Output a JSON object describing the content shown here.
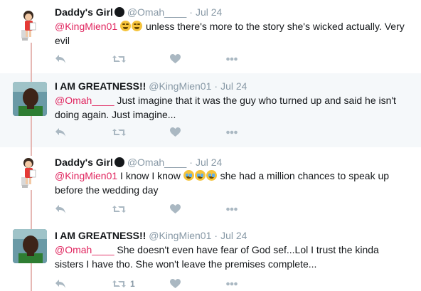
{
  "tweets": [
    {
      "author_name": "Daddy's Girl",
      "handle": "@Omah____",
      "time": "Jul 24",
      "mention": "@KingMien01",
      "emojis": [
        "joy-emoji",
        "joy-emoji"
      ],
      "text": "unless there's more to the story she's wicked actually. Very evil",
      "retweet_count": ""
    },
    {
      "author_name": "I AM GREATNESS!!",
      "handle": "@KingMien01",
      "time": "Jul 24",
      "mention": "@Omah____",
      "text": "Just imagine that it was the guy who turned up and said he isn't doing again. Just imagine...",
      "retweet_count": ""
    },
    {
      "author_name": "Daddy's Girl",
      "handle": "@Omah____",
      "time": "Jul 24",
      "mention": "@KingMien01",
      "text_before": "I know I know",
      "emojis": [
        "sob-emoji",
        "sob-emoji",
        "sob-emoji"
      ],
      "text": "she had a million chances to speak up before the wedding day",
      "retweet_count": ""
    },
    {
      "author_name": "I AM GREATNESS!!",
      "handle": "@KingMien01",
      "time": "Jul 24",
      "mention": "@Omah____",
      "text": "She doesn't even have fear of God sef...Lol I trust the kinda sisters I have tho. She won't leave the premises complete...",
      "retweet_count": "1"
    }
  ],
  "separator": "·",
  "icons": {
    "reply": "reply-icon",
    "retweet": "retweet-icon",
    "like": "heart-icon",
    "more": "more-icon"
  },
  "colors": {
    "mention": "#e0245e",
    "muted": "#8899a6",
    "icon": "#aab8c2",
    "thread_line": "#e6b8b4",
    "highlight_bg": "#f5f8fa"
  }
}
